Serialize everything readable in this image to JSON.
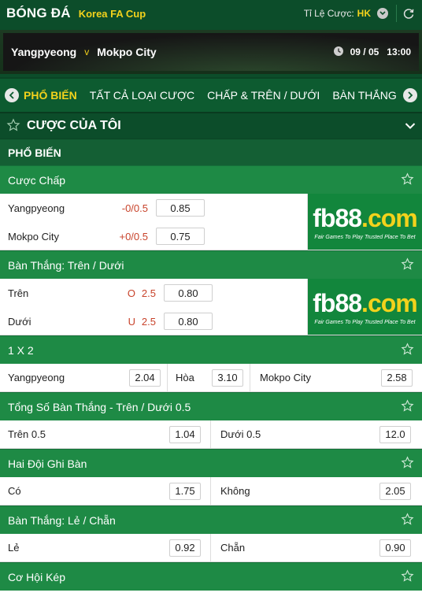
{
  "header": {
    "sport": "BÓNG ĐÁ",
    "league": "Korea FA Cup",
    "odds_label": "Tỉ Lệ Cược:",
    "odds_format": "HK"
  },
  "match": {
    "home": "Yangpyeong",
    "vs": "v",
    "away": "Mokpo City",
    "date": "09 / 05",
    "time": "13:00"
  },
  "tabs": [
    "PHỔ BIẾN",
    "TẤT CẢ LOẠI CƯỢC",
    "CHẤP & TRÊN / DƯỚI",
    "BÀN THẮNG"
  ],
  "my_bets": {
    "title": "CƯỢC CỦA TÔI"
  },
  "section": {
    "title": "PHỔ BIẾN"
  },
  "logo": {
    "brand_a": "fb88",
    "brand_b": ".com",
    "tagline": "Fair Games To Play   Trusted Place To Bet"
  },
  "markets": {
    "handicap": {
      "title": "Cược Chấp",
      "rows": [
        {
          "name": "Yangpyeong",
          "line": "-0/0.5",
          "odds": "0.85"
        },
        {
          "name": "Mokpo City",
          "line": "+0/0.5",
          "odds": "0.75"
        }
      ]
    },
    "over_under": {
      "title": "Bàn Thắng: Trên / Dưới",
      "rows": [
        {
          "name": "Trên",
          "tag": "O",
          "line": "2.5",
          "odds": "0.80"
        },
        {
          "name": "Dưới",
          "tag": "U",
          "line": "2.5",
          "odds": "0.80"
        }
      ]
    },
    "one_x_two": {
      "title": "1 X 2",
      "home": {
        "label": "Yangpyeong",
        "odds": "2.04"
      },
      "draw": {
        "label": "Hòa",
        "odds": "3.10"
      },
      "away": {
        "label": "Mokpo City",
        "odds": "2.58"
      }
    },
    "total_05": {
      "title": "Tổng Số Bàn Thắng - Trên / Dưới 0.5",
      "over": {
        "label": "Trên 0.5",
        "odds": "1.04"
      },
      "under": {
        "label": "Dưới 0.5",
        "odds": "12.0"
      }
    },
    "btts": {
      "title": "Hai Đội Ghi Bàn",
      "yes": {
        "label": "Có",
        "odds": "1.75"
      },
      "no": {
        "label": "Không",
        "odds": "2.05"
      }
    },
    "odd_even": {
      "title": "Bàn Thắng: Lẻ / Chẵn",
      "odd": {
        "label": "Lẻ",
        "odds": "0.92"
      },
      "even": {
        "label": "Chẵn",
        "odds": "0.90"
      }
    },
    "double_chance": {
      "title": "Cơ Hội Kép"
    }
  },
  "icons": {
    "refresh": "refresh-icon",
    "chevron": "chevron-down-icon",
    "star": "star-outline-icon",
    "clock": "clock-icon"
  },
  "colors": {
    "dark_green": "#0c4d2a",
    "market_green": "#1e8a45",
    "accent_yellow": "#f2d21c",
    "handicap_red": "#c8432b"
  }
}
